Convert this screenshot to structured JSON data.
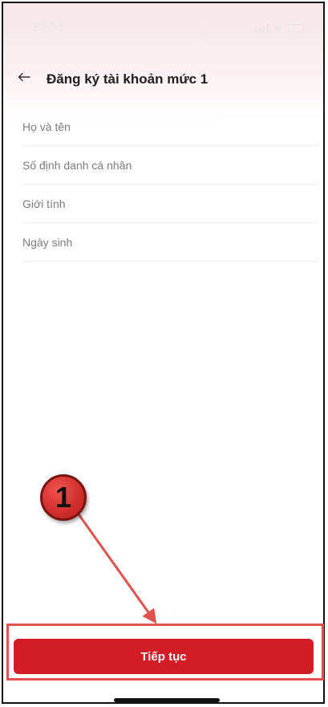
{
  "status_bar": {
    "time": "23:51",
    "icons": [
      "signal-icon",
      "wifi-icon",
      "battery-icon"
    ]
  },
  "header": {
    "back_icon": "arrow-left-icon",
    "title": "Đăng ký tài khoản mức 1"
  },
  "form": {
    "fields": [
      {
        "label": "Họ và tên",
        "value": ""
      },
      {
        "label": "Số định danh cá nhân",
        "value": ""
      },
      {
        "label": "Giới tính",
        "value": ""
      },
      {
        "label": "Ngày sinh",
        "value": ""
      }
    ]
  },
  "annotation": {
    "step_number": "1",
    "color": "#e2524c"
  },
  "footer": {
    "continue_label": "Tiếp tục"
  },
  "colors": {
    "primary": "#d21c26",
    "header_tint": "#f6e6e7"
  }
}
